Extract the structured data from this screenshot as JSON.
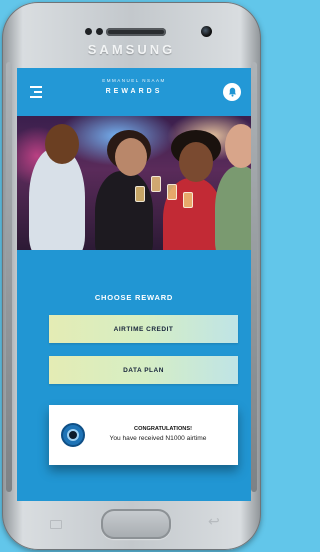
{
  "device": {
    "brand": "SAMSUNG"
  },
  "header": {
    "subtitle": "EMMANUEL NSAAM",
    "title": "REWARDS"
  },
  "main": {
    "section_title": "CHOOSE REWARD",
    "rewards": [
      {
        "label": "AIRTIME CREDIT"
      },
      {
        "label": "DATA PLAN"
      }
    ]
  },
  "notification": {
    "title": "CONGRATULATIONS!",
    "message": "You have received N1000 airtime"
  },
  "icons": {
    "menu": "menu-icon",
    "bell": "bell-icon",
    "reward": "lens-icon",
    "recent_apps": "recent-apps-icon",
    "back": "back-icon"
  },
  "colors": {
    "background": "#62c6ea",
    "screen": "#2196d3",
    "button_gradient_start": "#e4ecb4",
    "button_gradient_end": "#bfe4e6"
  }
}
